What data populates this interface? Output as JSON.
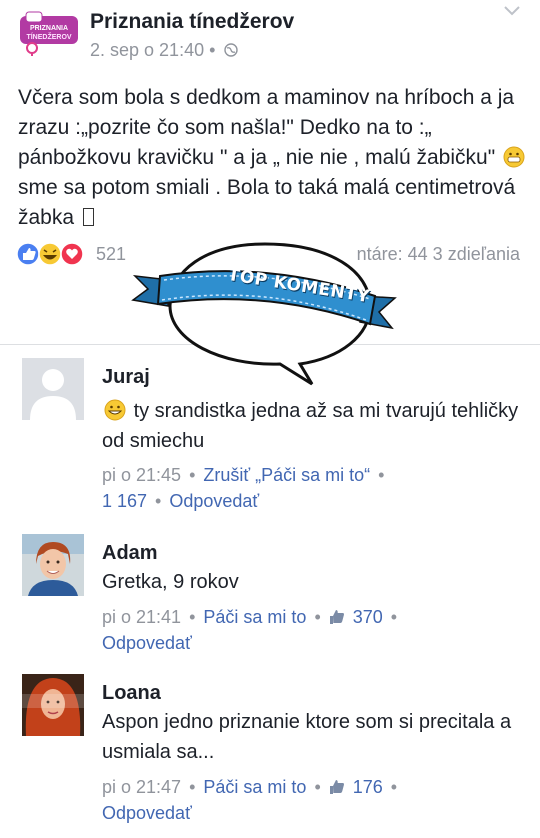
{
  "post": {
    "page_name": "Priznania tínedžerov",
    "date": "2. sep o 21:40",
    "text_part1": "Včera som bola s dedkom a maminov na hríboch a ja zrazu :„pozrite čo som našla!\" Dedko na to :„ pánbožkovu kravičku \" a ja „ nie nie , malú žabičku\"",
    "text_part2": "sme sa potom smiali . Bola to taká malá centimetrová žabka",
    "reaction_count": "521",
    "stats": "ntáre: 44 3 zdieľania",
    "logo_text": "PRIZNANIA TÍNEDŽEROV"
  },
  "banner": {
    "label": "TOP KOMENTY"
  },
  "comments": [
    {
      "author": "Juraj",
      "text": "ty srandistka jedna až sa mi tvarujú tehličky od smiechu",
      "time": "pi o 21:45",
      "cancel_like": "Zrušiť „Páči sa mi to“",
      "likes": "1 167",
      "reply": "Odpovedať"
    },
    {
      "author": "Adam",
      "text": "Gretka, 9 rokov",
      "time": "pi o 21:41",
      "like": "Páči sa mi to",
      "likes": "370",
      "reply": "Odpovedať"
    },
    {
      "author": "Loana",
      "text": "Aspon jedno priznanie ktore som si precitala a usmiala sa...",
      "time": "pi o 21:47",
      "like": "Páči sa mi to",
      "likes": "176",
      "reply": "Odpovedať"
    }
  ],
  "colors": {
    "link": "#4267b2",
    "meta": "#90949c",
    "ribbon": "#2f8fcf"
  }
}
